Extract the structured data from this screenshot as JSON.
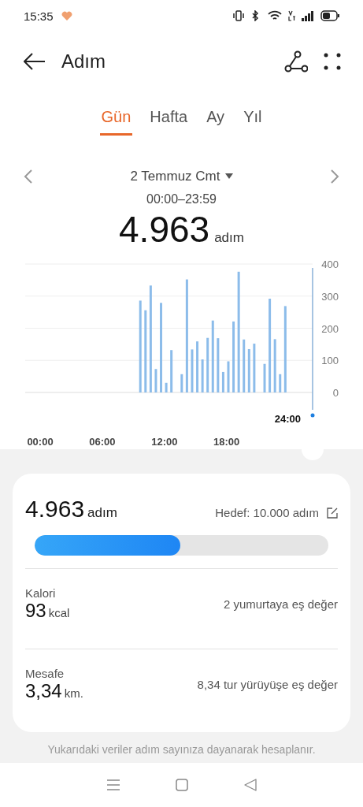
{
  "status_bar": {
    "time": "15:35"
  },
  "header": {
    "title": "Adım"
  },
  "tabs": [
    {
      "label": "Gün",
      "selected": true
    },
    {
      "label": "Hafta",
      "selected": false
    },
    {
      "label": "Ay",
      "selected": false
    },
    {
      "label": "Yıl",
      "selected": false
    }
  ],
  "date_nav": {
    "date": "2 Temmuz Cmt",
    "range": "00:00–23:59"
  },
  "total": {
    "value": "4.963",
    "unit": "adım"
  },
  "chart": {
    "cursor_label": "24:00",
    "chart_data": {
      "type": "bar",
      "x": [
        9.5,
        10,
        10.5,
        11,
        11.5,
        12,
        12.5,
        13.5,
        14,
        14.5,
        15,
        15.5,
        16,
        16.5,
        17,
        17.5,
        18,
        18.5,
        19,
        19.5,
        20,
        20.5,
        21.5,
        22,
        22.5,
        23,
        23.5
      ],
      "values": [
        286,
        256,
        333,
        73,
        279,
        30,
        132,
        57,
        352,
        134,
        159,
        103,
        170,
        224,
        169,
        64,
        97,
        221,
        376,
        165,
        135,
        152,
        89,
        292,
        166,
        57,
        269
      ],
      "xlim": [
        0,
        24
      ],
      "ylim": [
        0,
        400
      ],
      "yticks": [
        0,
        100,
        200,
        300,
        400
      ],
      "grid": true,
      "xticks": [
        {
          "value": 0,
          "label": "00:00"
        },
        {
          "value": 6,
          "label": "06:00"
        },
        {
          "value": 12,
          "label": "12:00"
        },
        {
          "value": 18,
          "label": "18:00"
        }
      ]
    }
  },
  "summary": {
    "value": "4.963",
    "unit": "adım",
    "goal": "Hedef: 10.000 adım",
    "level": 0.4963,
    "stats": [
      {
        "label": "Kalori",
        "value": "93",
        "unit": "kcal",
        "note": "2 yumurtaya eş değer"
      },
      {
        "label": "Mesafe",
        "value": "3,34",
        "unit": "km.",
        "note": "8,34 tur yürüyüşe eş değer"
      }
    ]
  },
  "footnote": "Yukarıdaki veriler adım sayınıza dayanarak hesaplanır."
}
